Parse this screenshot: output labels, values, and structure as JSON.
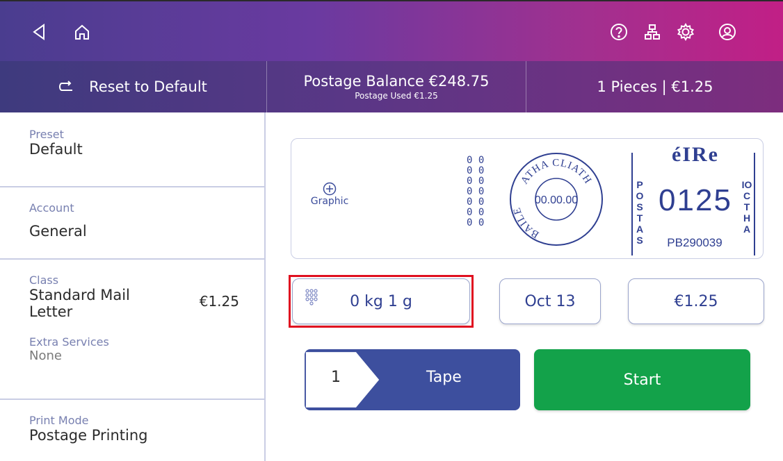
{
  "topbar": {
    "icons": [
      "back-icon",
      "home-icon",
      "help-icon",
      "network-icon",
      "settings-icon",
      "account-icon"
    ]
  },
  "header": {
    "reset_label": "Reset to Default",
    "balance_label": "Postage Balance €248.75",
    "used_label": "Postage Used €1.25",
    "pieces_label": "1 Pieces | €1.25"
  },
  "sidebar": {
    "preset": {
      "label": "Preset",
      "value": "Default"
    },
    "account": {
      "label": "Account",
      "value": "General"
    },
    "class": {
      "label": "Class",
      "value_line1": "Standard Mail",
      "value_line2": "Letter",
      "price": "€1.25"
    },
    "extra": {
      "label": "Extra Services",
      "value": "None"
    },
    "print_mode": {
      "label": "Print Mode",
      "value": "Postage Printing"
    }
  },
  "stamp": {
    "graphic_label": "Graphic",
    "counter_rows": [
      "0 0",
      "0 0",
      "0 0",
      "0 0",
      "0 0",
      "0 0",
      "0 0"
    ],
    "postmark_top": "ATHA CLIATH",
    "postmark_left": "BAILE",
    "postmark_date": "00.00.00",
    "country": "éIRe",
    "amount": "0125",
    "left_vertical": "POSTAS",
    "right_vertical": "IOCTHA",
    "meter_id": "PB290039"
  },
  "controls": {
    "weight": "0 kg 1 g",
    "date": "Oct 13",
    "postage": "€1.25",
    "tape_count": "1",
    "tape_label": "Tape",
    "start_label": "Start"
  },
  "colors": {
    "accent_blue": "#3d4f9e",
    "start_green": "#13a24a",
    "highlight_red": "#e01020"
  }
}
